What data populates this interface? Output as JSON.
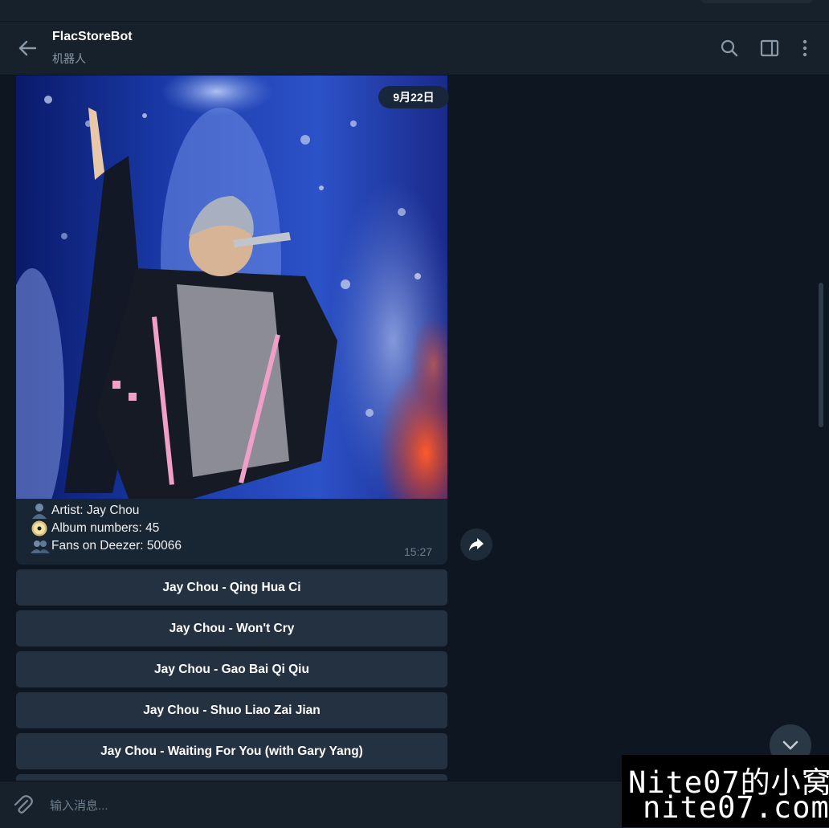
{
  "header": {
    "title": "FlacStoreBot",
    "subtitle": "机器人",
    "back_icon": "arrow-left-icon",
    "actions": [
      "search-icon",
      "sidebar-panel-icon",
      "more-vertical-icon"
    ]
  },
  "message": {
    "date_badge": "9月22日",
    "photo_description_icon": "concert-photo",
    "caption": [
      {
        "icon": "bust-in-silhouette-icon",
        "text": "Artist: Jay Chou"
      },
      {
        "icon": "dvd-disc-icon",
        "text": "Album numbers: 45"
      },
      {
        "icon": "busts-in-silhouette-icon",
        "text": "Fans on Deezer: 50066"
      }
    ],
    "time": "15:27"
  },
  "keyboard": {
    "buttons": [
      "Jay Chou - Qing Hua Ci",
      "Jay Chou - Won't Cry",
      "Jay Chou - Gao Bai Qi Qiu",
      "Jay Chou - Shuo Liao Zai Jian",
      "Jay Chou - Waiting For You (with Gary Yang)"
    ]
  },
  "composer": {
    "placeholder": "输入消息..."
  },
  "watermark": {
    "line1": "Nite07的小窝",
    "line2": "nite07.com"
  },
  "colors": {
    "background": "#0e1621",
    "header": "#17212b",
    "bubble": "#182533",
    "button": "#233140",
    "muted_text": "#6d7f8f"
  }
}
